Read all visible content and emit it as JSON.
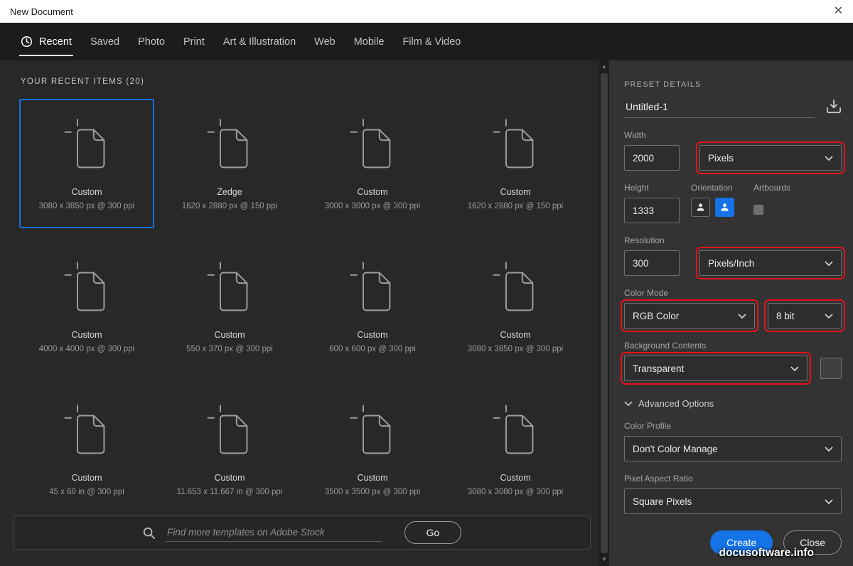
{
  "window": {
    "title": "New Document"
  },
  "icons": {
    "close": "✕",
    "scroll_up": "▲",
    "scroll_down": "▼"
  },
  "tabs": [
    {
      "label": "Recent",
      "active": true,
      "icon": "clock-icon"
    },
    {
      "label": "Saved"
    },
    {
      "label": "Photo"
    },
    {
      "label": "Print"
    },
    {
      "label": "Art & Illustration"
    },
    {
      "label": "Web"
    },
    {
      "label": "Mobile"
    },
    {
      "label": "Film & Video"
    }
  ],
  "recent": {
    "header": "YOUR RECENT ITEMS  (20)",
    "items": [
      {
        "name": "Custom",
        "dims": "3080 x 3850 px @ 300 ppi",
        "selected": true
      },
      {
        "name": "Zedge",
        "dims": "1620 x 2880 px @ 150 ppi",
        "selected": false
      },
      {
        "name": "Custom",
        "dims": "3000 x 3000 px @ 300 ppi",
        "selected": false
      },
      {
        "name": "Custom",
        "dims": "1620 x 2880 px @ 150 ppi",
        "selected": false
      },
      {
        "name": "Custom",
        "dims": "4000 x 4000 px @ 300 ppi",
        "selected": false
      },
      {
        "name": "Custom",
        "dims": "550 x 370 px @ 300 ppi",
        "selected": false
      },
      {
        "name": "Custom",
        "dims": "600 x 600 px @ 300 ppi",
        "selected": false
      },
      {
        "name": "Custom",
        "dims": "3080 x 3850 px @ 300 ppi",
        "selected": false
      },
      {
        "name": "Custom",
        "dims": "45 x 60 in @ 300 ppi",
        "selected": false
      },
      {
        "name": "Custom",
        "dims": "11.653 x 11.667 in @ 300 ppi",
        "selected": false
      },
      {
        "name": "Custom",
        "dims": "3500 x 3500 px @ 300 ppi",
        "selected": false
      },
      {
        "name": "Custom",
        "dims": "3080 x 3080 px @ 300 ppi",
        "selected": false
      }
    ]
  },
  "search": {
    "placeholder": "Find more templates on Adobe Stock",
    "go_label": "Go"
  },
  "preset": {
    "header": "PRESET DETAILS",
    "doc_name": "Untitled-1",
    "width": {
      "label": "Width",
      "value": "2000",
      "unit": "Pixels"
    },
    "height": {
      "label": "Height",
      "value": "1333"
    },
    "orientation_label": "Orientation",
    "artboards_label": "Artboards",
    "resolution": {
      "label": "Resolution",
      "value": "300",
      "unit": "Pixels/Inch"
    },
    "color_mode": {
      "label": "Color Mode",
      "value": "RGB Color",
      "depth": "8 bit"
    },
    "background": {
      "label": "Background Contents",
      "value": "Transparent"
    },
    "advanced_label": "Advanced Options",
    "color_profile": {
      "label": "Color Profile",
      "value": "Don't Color Manage"
    },
    "pixel_aspect": {
      "label": "Pixel Aspect Ratio",
      "value": "Square Pixels"
    },
    "create_label": "Create",
    "close_label": "Close"
  },
  "watermark": "docusoftware.info",
  "colors": {
    "accent_blue": "#1473e6",
    "annotation_red": "#e3131b",
    "selected_border": "#1473e6",
    "titlebar_bg": "#ffffff",
    "panel_bg": "#333333",
    "content_bg": "#282828"
  }
}
